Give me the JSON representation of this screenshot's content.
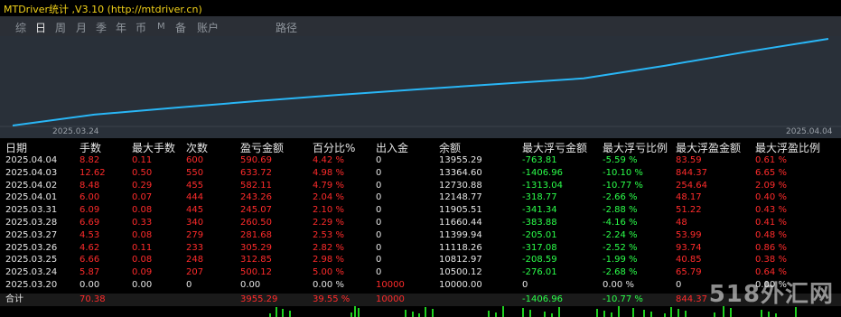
{
  "window": {
    "title": "MTDriver统计 ,V3.10 (http://mtdriver.cn)"
  },
  "tabs": [
    {
      "label": "综",
      "active": false
    },
    {
      "label": "日",
      "active": true
    },
    {
      "label": "周",
      "active": false
    },
    {
      "label": "月",
      "active": false
    },
    {
      "label": "季",
      "active": false
    },
    {
      "label": "年",
      "active": false
    },
    {
      "label": "币",
      "active": false
    },
    {
      "label": "M",
      "active": false
    },
    {
      "label": "备",
      "active": false
    },
    {
      "label": "账户",
      "active": false
    },
    {
      "label": "路径",
      "active": false
    }
  ],
  "chart_data": {
    "type": "line",
    "x": [
      "2025.03.20",
      "2025.03.24",
      "2025.03.25",
      "2025.03.26",
      "2025.03.27",
      "2025.03.28",
      "2025.03.31",
      "2025.04.01",
      "2025.04.02",
      "2025.04.03",
      "2025.04.04"
    ],
    "series": [
      {
        "values": [
          10000.0,
          10500.12,
          10812.97,
          11118.26,
          11399.94,
          11660.44,
          11905.51,
          12148.77,
          12730.88,
          13364.6,
          13955.29
        ]
      }
    ],
    "tick_labels": [
      "2025.03.24",
      "2025.04.04"
    ],
    "line_color": "#29b6f6"
  },
  "table": {
    "headers": [
      "日期",
      "手数",
      "最大手数",
      "次数",
      "盈亏金额",
      "百分比%",
      "出入金",
      "余额",
      "最大浮亏金额",
      "最大浮亏比例",
      "最大浮盈金额",
      "最大浮盈比例"
    ],
    "rows": [
      [
        "2025.04.04",
        "8.82",
        "0.11",
        "600",
        "590.69",
        "4.42 %",
        "0",
        "13955.29",
        "-763.81",
        "-5.59 %",
        "83.59",
        "0.61 %"
      ],
      [
        "2025.04.03",
        "12.62",
        "0.50",
        "550",
        "633.72",
        "4.98 %",
        "0",
        "13364.60",
        "-1406.96",
        "-10.10 %",
        "844.37",
        "6.65 %"
      ],
      [
        "2025.04.02",
        "8.48",
        "0.29",
        "455",
        "582.11",
        "4.79 %",
        "0",
        "12730.88",
        "-1313.04",
        "-10.77 %",
        "254.64",
        "2.09 %"
      ],
      [
        "2025.04.01",
        "6.00",
        "0.07",
        "444",
        "243.26",
        "2.04 %",
        "0",
        "12148.77",
        "-318.77",
        "-2.66 %",
        "48.17",
        "0.40 %"
      ],
      [
        "2025.03.31",
        "6.09",
        "0.08",
        "445",
        "245.07",
        "2.10 %",
        "0",
        "11905.51",
        "-341.34",
        "-2.88 %",
        "51.22",
        "0.43 %"
      ],
      [
        "2025.03.28",
        "6.69",
        "0.33",
        "340",
        "260.50",
        "2.29 %",
        "0",
        "11660.44",
        "-383.88",
        "-4.16 %",
        "48",
        "0.41 %"
      ],
      [
        "2025.03.27",
        "4.53",
        "0.08",
        "279",
        "281.68",
        "2.53 %",
        "0",
        "11399.94",
        "-205.01",
        "-2.24 %",
        "53.99",
        "0.48 %"
      ],
      [
        "2025.03.26",
        "4.62",
        "0.11",
        "233",
        "305.29",
        "2.82 %",
        "0",
        "11118.26",
        "-317.08",
        "-2.52 %",
        "93.74",
        "0.86 %"
      ],
      [
        "2025.03.25",
        "6.66",
        "0.08",
        "248",
        "312.85",
        "2.98 %",
        "0",
        "10812.97",
        "-208.59",
        "-1.99 %",
        "40.85",
        "0.38 %"
      ],
      [
        "2025.03.24",
        "5.87",
        "0.09",
        "207",
        "500.12",
        "5.00 %",
        "0",
        "10500.12",
        "-276.01",
        "-2.68 %",
        "65.79",
        "0.64 %"
      ],
      [
        "2025.03.20",
        "0.00",
        "0.00",
        "0",
        "0.00",
        "0.00 %",
        "10000",
        "10000.00",
        "0",
        "0.00 %",
        "0",
        "0.00 %"
      ]
    ],
    "total": [
      "合计",
      "70.38",
      "",
      "",
      "3955.29",
      "39.55 %",
      "10000",
      "",
      "-1406.96",
      "-10.77 %",
      "844.37",
      ""
    ]
  },
  "colors": {
    "header_bg": "#2b2f36",
    "chart_bg": "#293039",
    "positive": "#ff2b2b",
    "negative": "#2bff4a",
    "title": "#f2d21a"
  },
  "watermark": {
    "text": "518外汇网"
  }
}
